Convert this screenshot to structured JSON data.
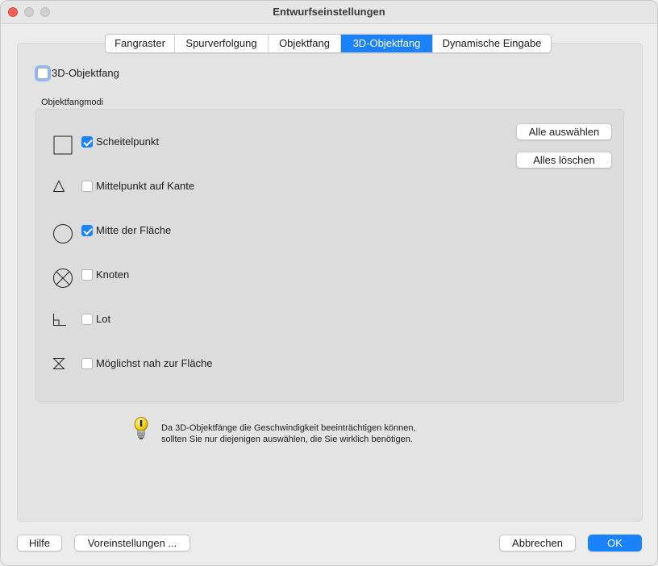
{
  "window": {
    "title": "Entwurfseinstellungen"
  },
  "tabs": [
    {
      "label": "Fangraster",
      "active": false
    },
    {
      "label": "Spurverfolgung",
      "active": false
    },
    {
      "label": "Objektfang",
      "active": false
    },
    {
      "label": "3D-Objektfang",
      "active": true
    },
    {
      "label": "Dynamische Eingabe",
      "active": false
    }
  ],
  "enable_3d_osnap": {
    "label": "3D-Objektfang",
    "checked": false
  },
  "snap_modes": {
    "group_label": "Objektfangmodi",
    "items": [
      {
        "label": "Scheitelpunkt",
        "checked": true,
        "icon": "square-icon"
      },
      {
        "label": "Mittelpunkt auf Kante",
        "checked": false,
        "icon": "triangle-icon"
      },
      {
        "label": "Mitte der Fläche",
        "checked": true,
        "icon": "circle-icon"
      },
      {
        "label": "Knoten",
        "checked": false,
        "icon": "node-icon"
      },
      {
        "label": "Lot",
        "checked": false,
        "icon": "perpendicular-icon"
      },
      {
        "label": "Möglichst nah zur Fläche",
        "checked": false,
        "icon": "hourglass-icon"
      }
    ],
    "select_all_label": "Alle auswählen",
    "clear_all_label": "Alles löschen"
  },
  "info": {
    "line1": "Da 3D-Objektfänge die Geschwindigkeit beeinträchtigen können,",
    "line2": "sollten Sie nur diejenigen auswählen, die Sie wirklich benötigen.",
    "icon": "lightbulb-icon"
  },
  "footer": {
    "help_label": "Hilfe",
    "defaults_label": "Voreinstellungen ...",
    "cancel_label": "Abbrechen",
    "ok_label": "OK"
  },
  "colors": {
    "accent": "#1a82fb",
    "close": "#fe5f57"
  }
}
